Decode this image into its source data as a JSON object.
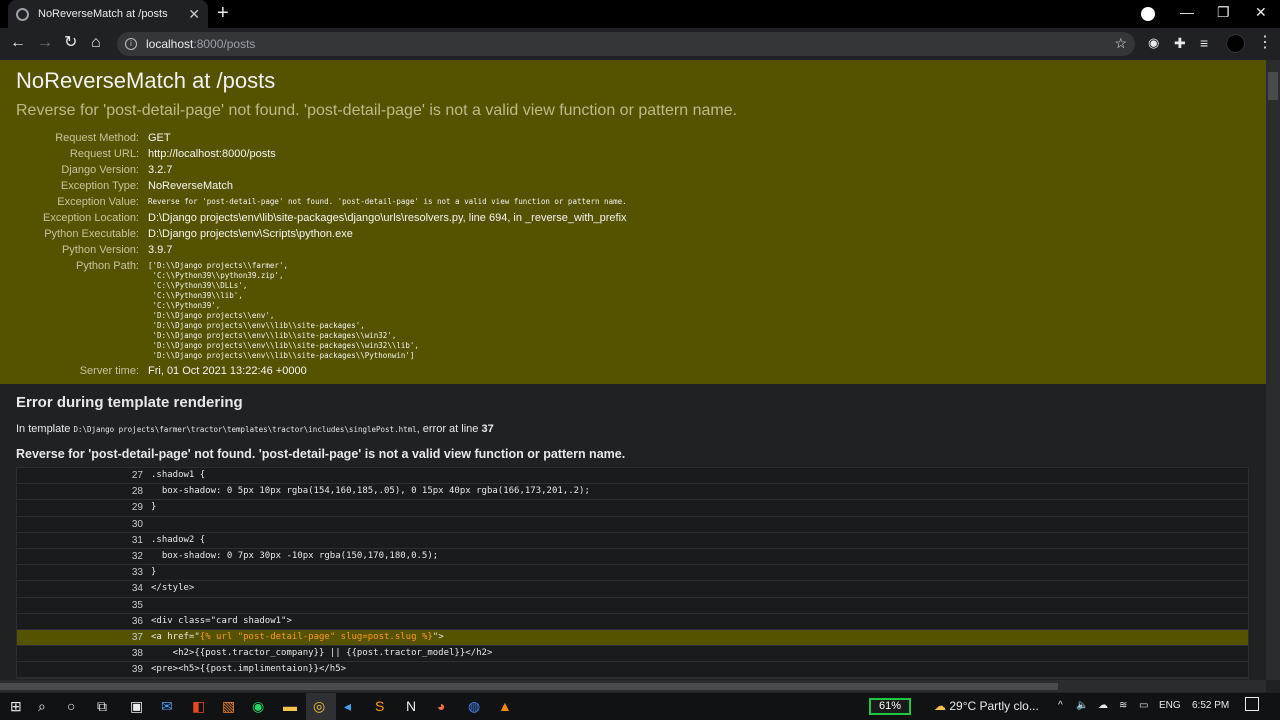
{
  "browser": {
    "tab_title": "NoReverseMatch at /posts",
    "address_host": "localhost",
    "address_path": ":8000/posts"
  },
  "summary": {
    "title": "NoReverseMatch at /posts",
    "subtitle": "Reverse for 'post-detail-page' not found. 'post-detail-page' is not a valid view function or pattern name.",
    "rows": [
      {
        "key": "Request Method:",
        "value": "GET"
      },
      {
        "key": "Request URL:",
        "value": "http://localhost:8000/posts"
      },
      {
        "key": "Django Version:",
        "value": "3.2.7"
      },
      {
        "key": "Exception Type:",
        "value": "NoReverseMatch"
      },
      {
        "key": "Exception Value:",
        "value": "Reverse for 'post-detail-page' not found. 'post-detail-page' is not a valid view function or pattern name."
      },
      {
        "key": "Exception Location:",
        "value": "D:\\Django projects\\env\\lib\\site-packages\\django\\urls\\resolvers.py, line 694, in _reverse_with_prefix"
      },
      {
        "key": "Python Executable:",
        "value": "D:\\Django projects\\env\\Scripts\\python.exe"
      },
      {
        "key": "Python Version:",
        "value": "3.9.7"
      }
    ],
    "python_path_label": "Python Path:",
    "python_path": "['D:\\\\Django projects\\\\farmer',\n 'C:\\\\Python39\\\\python39.zip',\n 'C:\\\\Python39\\\\DLLs',\n 'C:\\\\Python39\\\\lib',\n 'C:\\\\Python39',\n 'D:\\\\Django projects\\\\env',\n 'D:\\\\Django projects\\\\env\\\\lib\\\\site-packages',\n 'D:\\\\Django projects\\\\env\\\\lib\\\\site-packages\\\\win32',\n 'D:\\\\Django projects\\\\env\\\\lib\\\\site-packages\\\\win32\\\\lib',\n 'D:\\\\Django projects\\\\env\\\\lib\\\\site-packages\\\\Pythonwin']",
    "server_time_label": "Server time:",
    "server_time": "Fri, 01 Oct 2021 13:22:46 +0000"
  },
  "template_error": {
    "heading": "Error during template rendering",
    "intro_prefix": "In template",
    "template_path": "D:\\Django projects\\farmer\\tractor\\templates\\tractor\\includes\\singlePost.html",
    "intro_mid": ", error at line",
    "error_line": "37",
    "message": "Reverse for 'post-detail-page' not found. 'post-detail-page' is not a valid view function or pattern name.",
    "code_lines": [
      {
        "ln": "27",
        "code": ".shadow1 {"
      },
      {
        "ln": "28",
        "code": "  box-shadow: 0 5px 10px rgba(154,160,185,.05), 0 15px 40px rgba(166,173,201,.2);"
      },
      {
        "ln": "29",
        "code": "}"
      },
      {
        "ln": "30",
        "code": ""
      },
      {
        "ln": "31",
        "code": ".shadow2 {"
      },
      {
        "ln": "32",
        "code": "  box-shadow: 0 7px 30px -10px rgba(150,170,180,0.5);"
      },
      {
        "ln": "33",
        "code": "}"
      },
      {
        "ln": "34",
        "code": "</style>"
      },
      {
        "ln": "35",
        "code": ""
      },
      {
        "ln": "36",
        "code": "<div class=\"card shadow1\">"
      },
      {
        "ln": "37",
        "code_pre": "<a href=\"",
        "code_err": "{% url \"post-detail-page\" slug=post.slug %}",
        "code_post": "\">"
      },
      {
        "ln": "38",
        "code": "    <h2>{{post.tractor_company}} || {{post.tractor_model}}</h2>"
      },
      {
        "ln": "39",
        "code": "<pre><h5>{{post.implimentaion}}</h5>"
      }
    ]
  },
  "taskbar": {
    "battery": "61%",
    "weather": "29°C  Partly clo...",
    "lang": "ENG",
    "time": "6:52 PM"
  },
  "colors": {
    "summary_bg": "#555200",
    "page_bg": "#202124",
    "error_code": "#ff9c1a"
  }
}
